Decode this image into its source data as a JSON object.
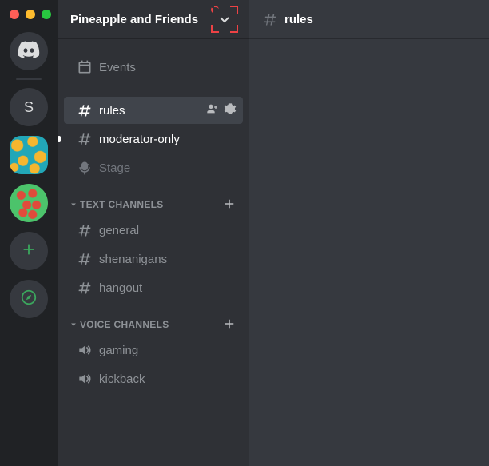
{
  "server_rail": {
    "home_label": "Home",
    "letter_server_initial": "S"
  },
  "sidebar": {
    "server_name": "Pineapple and Friends",
    "events_label": "Events",
    "top_channels": [
      {
        "name": "rules",
        "type": "text",
        "state": "selected"
      },
      {
        "name": "moderator-only",
        "type": "text",
        "state": "unread"
      },
      {
        "name": "Stage",
        "type": "stage",
        "state": "dimmed"
      }
    ],
    "categories": [
      {
        "title": "TEXT CHANNELS",
        "channels": [
          {
            "name": "general",
            "type": "text",
            "state": "normal"
          },
          {
            "name": "shenanigans",
            "type": "text",
            "state": "normal"
          },
          {
            "name": "hangout",
            "type": "text",
            "state": "normal"
          }
        ]
      },
      {
        "title": "VOICE CHANNELS",
        "channels": [
          {
            "name": "gaming",
            "type": "voice",
            "state": "normal"
          },
          {
            "name": "kickback",
            "type": "voice",
            "state": "normal"
          }
        ]
      }
    ]
  },
  "main": {
    "channel_name": "rules"
  },
  "colors": {
    "bg_darkest": "#202225",
    "bg_sidebar": "#2f3136",
    "bg_main": "#36393f",
    "accent_green": "#3ba55d",
    "highlight_red": "#ed4245"
  }
}
